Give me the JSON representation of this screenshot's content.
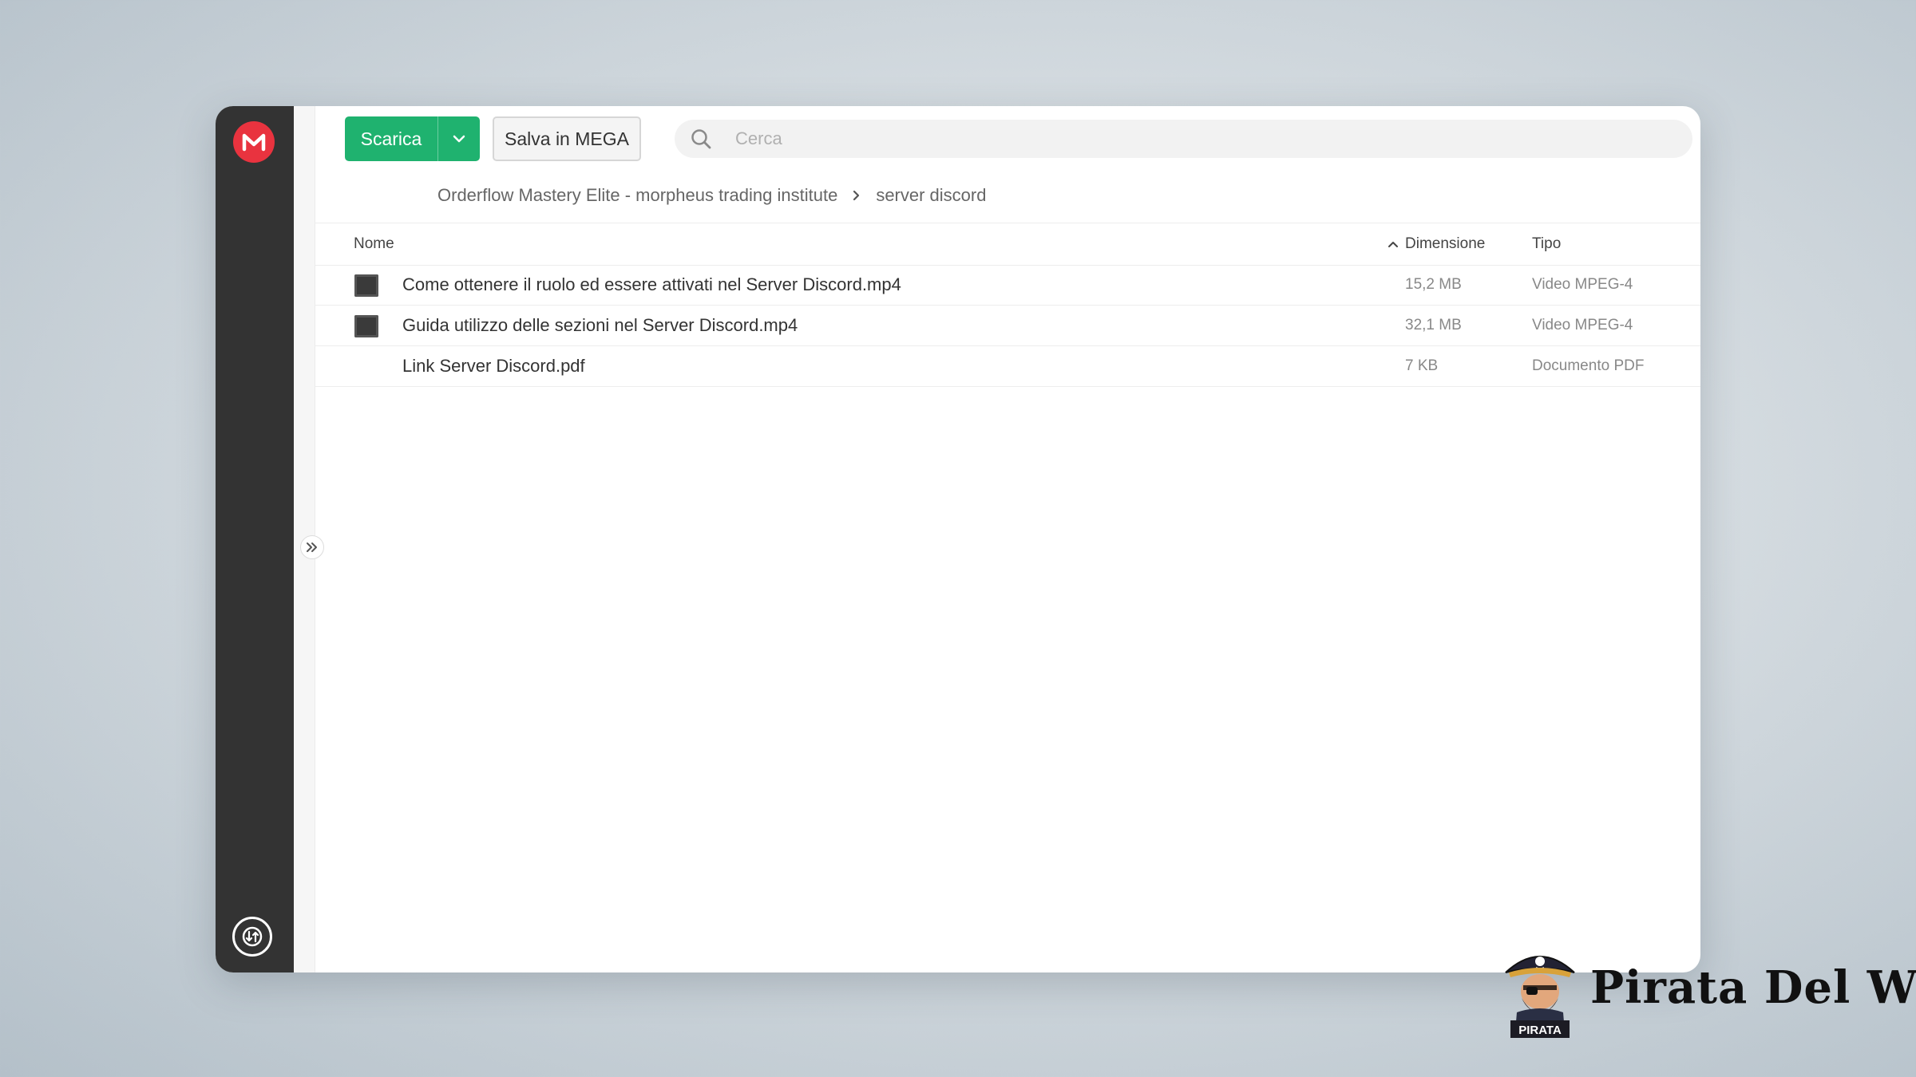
{
  "toolbar": {
    "download_label": "Scarica",
    "save_label": "Salva in MEGA"
  },
  "search": {
    "placeholder": "Cerca"
  },
  "breadcrumb": {
    "items": [
      "Orderflow Mastery Elite - morpheus trading institute",
      "server discord"
    ]
  },
  "file_list": {
    "columns": {
      "name": "Nome",
      "size": "Dimensione",
      "type": "Tipo"
    },
    "rows": [
      {
        "name": "Come ottenere il ruolo ed essere attivati nel Server Discord.mp4",
        "size": "15,2 MB",
        "type": "Video MPEG-4",
        "icon": "video-file-icon"
      },
      {
        "name": "Guida utilizzo delle sezioni nel Server Discord.mp4",
        "size": "32,1 MB",
        "type": "Video MPEG-4",
        "icon": "video-file-icon"
      },
      {
        "name": "Link Server Discord.pdf",
        "size": "7 KB",
        "type": "Documento PDF",
        "icon": "pdf-file-icon"
      }
    ]
  },
  "watermark": {
    "brand_text": "Pirata Del Web",
    "mascot_label": "PIRATA"
  },
  "colors": {
    "accent_green": "#1fb26f",
    "mega_red": "#e9333f",
    "sidebar": "#333333"
  }
}
